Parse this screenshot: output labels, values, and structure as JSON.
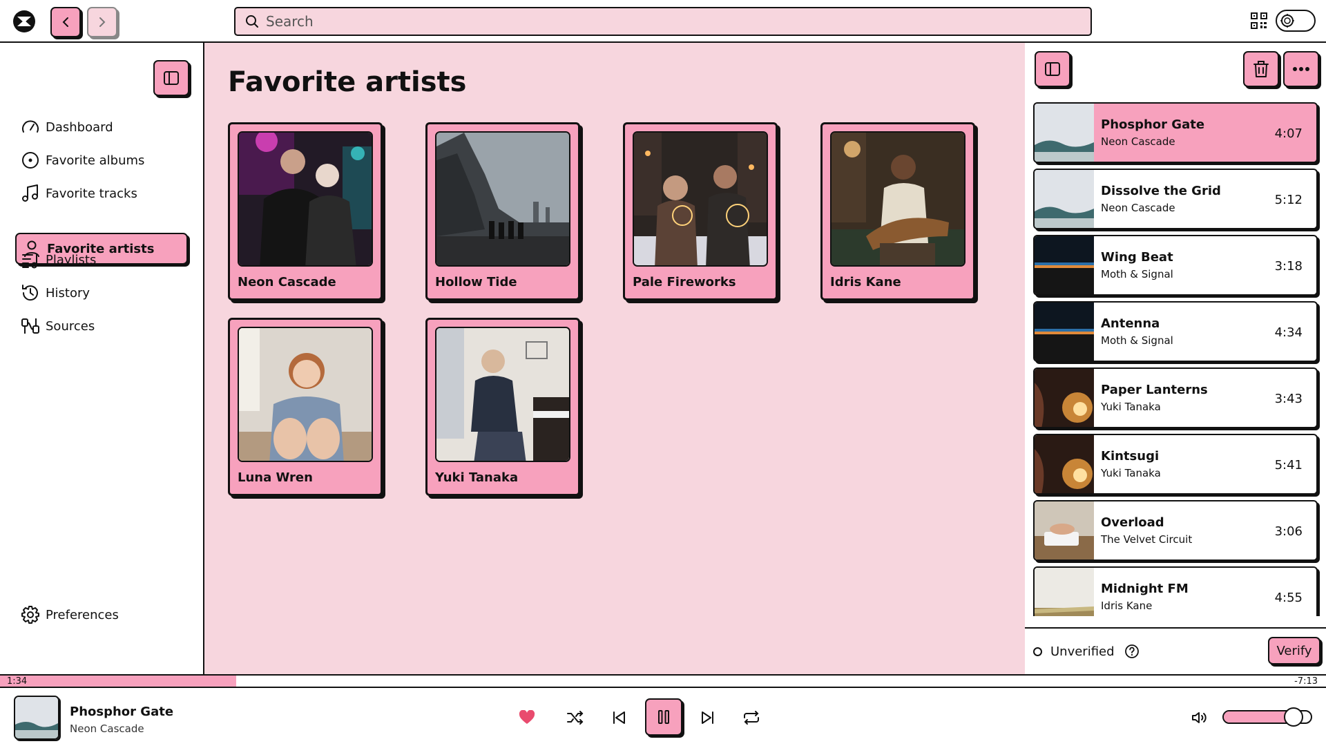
{
  "topbar": {
    "search_placeholder": "Search",
    "icons": [
      "app-logo",
      "back-icon",
      "forward-icon",
      "search-icon",
      "qr-code-icon",
      "theme-toggle-icon"
    ]
  },
  "sidebar": {
    "items": [
      {
        "label": "Dashboard",
        "icon": "gauge-icon"
      },
      {
        "label": "Favorite albums",
        "icon": "disc-icon"
      },
      {
        "label": "Favorite tracks",
        "icon": "music-note-icon"
      },
      {
        "label": "Favorite artists",
        "icon": "user-icon",
        "active": true
      },
      {
        "label": "Playlists",
        "icon": "playlist-icon"
      },
      {
        "label": "History",
        "icon": "history-icon"
      },
      {
        "label": "Sources",
        "icon": "sources-icon"
      }
    ],
    "preferences_label": "Preferences"
  },
  "main": {
    "title": "Favorite artists",
    "artists": [
      {
        "name": "Neon Cascade"
      },
      {
        "name": "Hollow Tide"
      },
      {
        "name": "Pale Fireworks"
      },
      {
        "name": "Idris Kane"
      },
      {
        "name": "Luna Wren"
      },
      {
        "name": "Yuki Tanaka"
      }
    ]
  },
  "queue": {
    "tracks": [
      {
        "title": "Phosphor Gate",
        "artist": "Neon Cascade",
        "duration": "4:07",
        "current": true
      },
      {
        "title": "Dissolve the Grid",
        "artist": "Neon Cascade",
        "duration": "5:12"
      },
      {
        "title": "Wing Beat",
        "artist": "Moth & Signal",
        "duration": "3:18"
      },
      {
        "title": "Antenna",
        "artist": "Moth & Signal",
        "duration": "4:34"
      },
      {
        "title": "Paper Lanterns",
        "artist": "Yuki Tanaka",
        "duration": "3:43"
      },
      {
        "title": "Kintsugi",
        "artist": "Yuki Tanaka",
        "duration": "5:41"
      },
      {
        "title": "Overload",
        "artist": "The Velvet Circuit",
        "duration": "3:06"
      },
      {
        "title": "Midnight FM",
        "artist": "Idris Kane",
        "duration": "4:55"
      }
    ],
    "status_label": "Unverified",
    "verify_label": "Verify"
  },
  "player": {
    "elapsed": "1:34",
    "remaining": "-7:13",
    "progress_fraction": 0.178,
    "volume_fraction": 0.8,
    "now_playing": {
      "title": "Phosphor Gate",
      "artist": "Neon Cascade"
    },
    "liked": true,
    "playing": true
  },
  "colors": {
    "accent": "#f7a1bd",
    "main_bg": "#f7d6de",
    "heart": "#e94b6e",
    "border": "#111111"
  }
}
